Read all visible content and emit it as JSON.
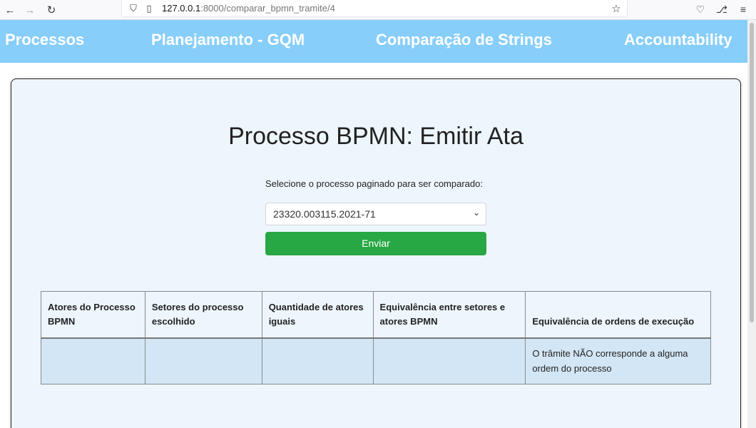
{
  "browser": {
    "url_host": "127.0.0.1",
    "url_rest": ":8000/comparar_bpmn_tramite/4",
    "icons": [
      "back-arrow-icon",
      "forward-arrow-icon",
      "reload-icon",
      "shield-icon",
      "page-icon",
      "star-icon",
      "pocket-icon",
      "extensions-icon",
      "menu-icon"
    ]
  },
  "navbar": {
    "items": [
      "Processos",
      "Planejamento - GQM",
      "Comparação de Strings",
      "Accountability"
    ],
    "color": "#87cefa"
  },
  "main": {
    "title": "Processo BPMN: Emitir Ata",
    "select_label": "Selecione o processo paginado para ser comparado:",
    "selected_process": "23320.003115.2021-71",
    "submit_label": "Enviar",
    "submit_color": "#28a745"
  },
  "table": {
    "headers": [
      "Atores do Processo BPMN",
      "Setores do processo escolhido",
      "Quantidade de atores iguais",
      "Equivalência entre setores e atores BPMN",
      "Equivalência de ordens de execução"
    ],
    "rows": [
      [
        "",
        "",
        "",
        "",
        "O trâmite NÃO corresponde a alguma ordem do processo"
      ]
    ]
  }
}
